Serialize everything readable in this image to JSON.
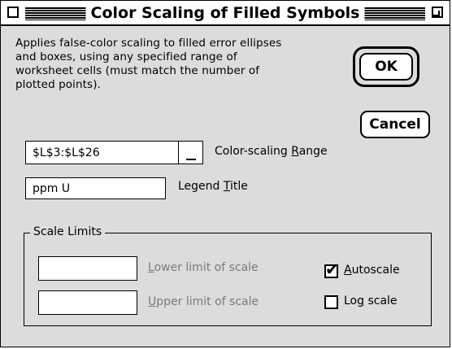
{
  "window": {
    "title": "Color Scaling of Filled Symbols"
  },
  "description": "Applies false-color scaling to filled error ellipses and boxes, using any specified range of worksheet cells (must match the number of plotted points).",
  "buttons": {
    "ok_label": "OK",
    "cancel_label": "Cancel"
  },
  "color_range": {
    "value": "$L$3:$L$26",
    "label_pre": "Color-scaling ",
    "label_mnemonic": "R",
    "label_post": "ange"
  },
  "legend_title": {
    "value": "ppm U",
    "label_pre": "Legend ",
    "label_mnemonic": "T",
    "label_post": "itle"
  },
  "scale_limits": {
    "group_label": "Scale Limits",
    "lower": {
      "value": "",
      "label_mnemonic": "L",
      "label_post": "ower limit of scale"
    },
    "upper": {
      "value": "",
      "label_mnemonic": "U",
      "label_post": "pper  limit of scale"
    },
    "autoscale": {
      "checked": true,
      "label_mnemonic": "A",
      "label_post": "utoscale"
    },
    "log_scale": {
      "checked": false,
      "label_pre": "Lo",
      "label_mnemonic": "g",
      "label_post": " scale"
    }
  }
}
